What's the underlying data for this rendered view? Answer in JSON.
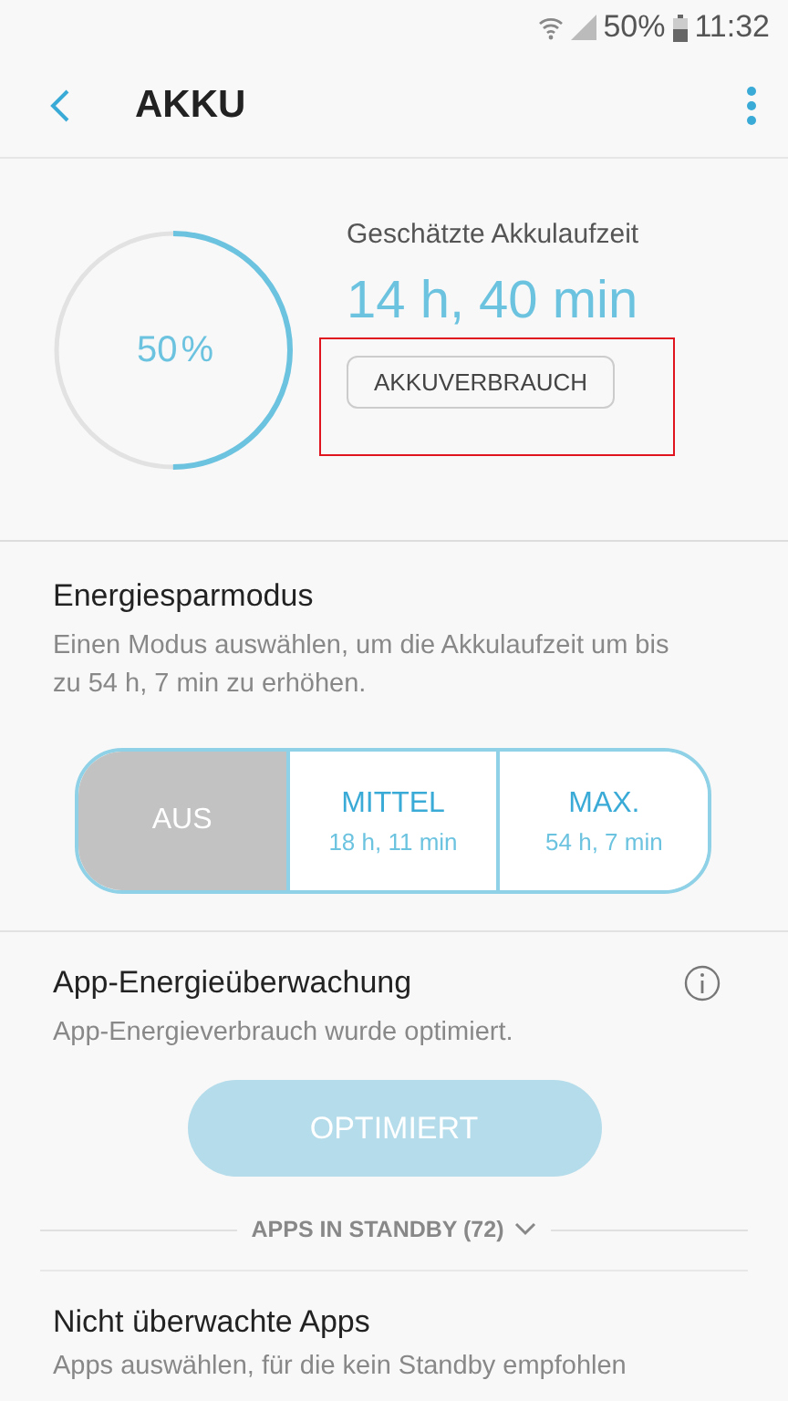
{
  "status_bar": {
    "battery": "50%",
    "time": "11:32"
  },
  "app_bar": {
    "title": "AKKU"
  },
  "summary": {
    "percent": "50",
    "percent_sign": "%",
    "estimate_label": "Geschätzte Akkulaufzeit",
    "estimate": "14 h, 40 min",
    "usage_button": {
      "label": "AKKUVERBRAUCH",
      "highlighted": true
    }
  },
  "power_saving": {
    "title": "Energiesparmodus",
    "description": "Einen Modus auswählen, um die Akkulaufzeit um bis zu 54 h, 7 min zu erhöhen.",
    "modes": [
      {
        "label": "AUS",
        "selected": true
      },
      {
        "label": "MITTEL",
        "time": "18 h, 11 min",
        "selected": false
      },
      {
        "label": "MAX.",
        "time": "54 h, 7 min",
        "selected": false
      }
    ]
  },
  "app_monitor": {
    "title": "App-Energieüberwachung",
    "description": "App-Energieverbrauch wurde optimiert.",
    "button": {
      "label": "OPTIMIERT",
      "disabled": true
    },
    "standby": {
      "label": "APPS IN STANDBY (72)",
      "expanded": false
    }
  },
  "unmonitored": {
    "title": "Nicht überwachte Apps",
    "description": "Apps auswählen, für die kein Standby empfohlen"
  }
}
